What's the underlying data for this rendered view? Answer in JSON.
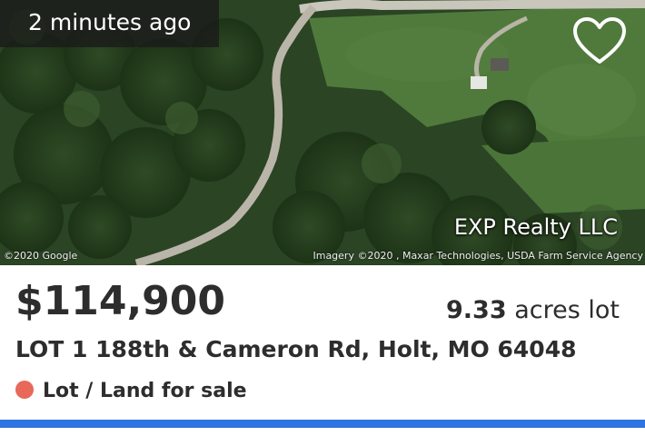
{
  "listing": {
    "time_ago": "2 minutes ago",
    "brokerage": "EXP Realty LLC",
    "imagery_credit_left": "©2020 Google",
    "imagery_credit_right": "Imagery ©2020 , Maxar Technologies, USDA Farm Service Agency",
    "price": "$114,900",
    "lot_size_value": "9.33",
    "lot_size_unit": "acres lot",
    "address": "LOT 1 188th & Cameron Rd, Holt, MO 64048",
    "status": "Lot / Land for sale",
    "favorited": false
  },
  "colors": {
    "accent": "#2f74e3",
    "status_dot": "#e8685a",
    "badge_bg": "#1a1a1a"
  },
  "icons": {
    "favorite": "heart-outline-icon",
    "status": "status-dot-icon"
  }
}
